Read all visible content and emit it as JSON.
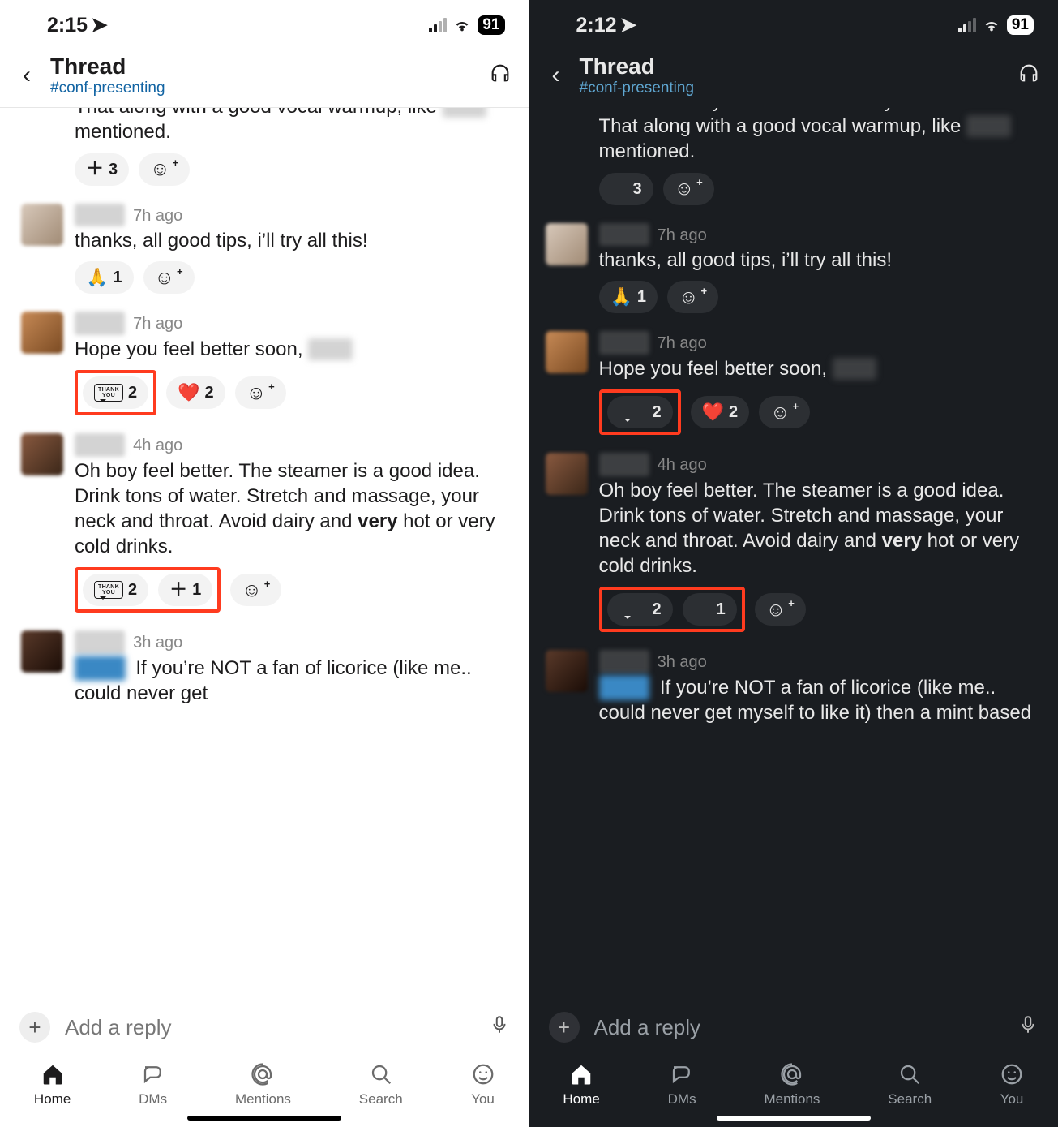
{
  "light": {
    "status": {
      "time": "2:15",
      "battery": "91"
    },
    "header": {
      "title": "Thread",
      "channel": "#conf-presenting"
    },
    "messages": [
      {
        "kind": "continuation",
        "text_parts": [
          "a ton of honey when I blew out my voice in theater. That along with a good vocal warmup, like ",
          {
            "blur": true
          },
          " mentioned."
        ],
        "reactions": [
          {
            "type": "plus",
            "count": "3"
          },
          {
            "type": "add"
          }
        ]
      },
      {
        "avatar": "av1",
        "ts": "7h ago",
        "text_parts": [
          "thanks, all good tips, i’ll try all this!"
        ],
        "reactions": [
          {
            "type": "emoji",
            "emoji": "🙏",
            "count": "1"
          },
          {
            "type": "add"
          }
        ]
      },
      {
        "avatar": "av2",
        "ts": "7h ago",
        "text_parts": [
          "Hope you feel better soon, ",
          {
            "blur": true
          }
        ],
        "reactions": [
          {
            "hl": true,
            "items": [
              {
                "type": "thankyou",
                "count": "2"
              }
            ]
          },
          {
            "type": "emoji",
            "emoji": "❤️",
            "count": "2"
          },
          {
            "type": "add"
          }
        ]
      },
      {
        "avatar": "av3",
        "ts": "4h ago",
        "text_parts": [
          "Oh boy feel better. The steamer is a good idea. Drink tons of water. Stretch and massage, your neck and throat. Avoid dairy and ",
          {
            "bold": "very"
          },
          " hot or very cold drinks."
        ],
        "reactions": [
          {
            "hl": true,
            "items": [
              {
                "type": "thankyou",
                "count": "2"
              },
              {
                "type": "plus",
                "count": "1"
              }
            ]
          },
          {
            "type": "add"
          }
        ]
      },
      {
        "avatar": "av4",
        "ts": "3h ago",
        "text_parts": [
          {
            "mention": true
          },
          " If you’re NOT a fan of licorice (like me.. could never get"
        ]
      }
    ],
    "input": {
      "placeholder": "Add a reply"
    },
    "tabs": [
      {
        "id": "home",
        "label": "Home",
        "active": true
      },
      {
        "id": "dms",
        "label": "DMs"
      },
      {
        "id": "mentions",
        "label": "Mentions"
      },
      {
        "id": "search",
        "label": "Search"
      },
      {
        "id": "you",
        "label": "You"
      }
    ]
  },
  "dark": {
    "status": {
      "time": "2:12",
      "battery": "91"
    },
    "header": {
      "title": "Thread",
      "channel": "#conf-presenting"
    },
    "messages": [
      {
        "kind": "continuation",
        "text_parts": [
          "a ton of honey when I blew out my voice in theater. That along with a good vocal warmup, like ",
          {
            "blur": true
          },
          " mentioned."
        ],
        "reactions": [
          {
            "type": "plus",
            "count": "3"
          },
          {
            "type": "add"
          }
        ]
      },
      {
        "avatar": "av1",
        "ts": "7h ago",
        "text_parts": [
          "thanks, all good tips, i’ll try all this!"
        ],
        "reactions": [
          {
            "type": "emoji",
            "emoji": "🙏",
            "count": "1"
          },
          {
            "type": "add"
          }
        ]
      },
      {
        "avatar": "av2",
        "ts": "7h ago",
        "text_parts": [
          "Hope you feel better soon, ",
          {
            "blur": true
          }
        ],
        "reactions": [
          {
            "hl": true,
            "items": [
              {
                "type": "thankyou",
                "count": "2"
              }
            ]
          },
          {
            "type": "emoji",
            "emoji": "❤️",
            "count": "2"
          },
          {
            "type": "add"
          }
        ]
      },
      {
        "avatar": "av3",
        "ts": "4h ago",
        "text_parts": [
          "Oh boy feel better. The steamer is a good idea. Drink tons of water. Stretch and massage, your neck and throat. Avoid dairy and ",
          {
            "bold": "very"
          },
          " hot or very cold drinks."
        ],
        "reactions": [
          {
            "hl": true,
            "items": [
              {
                "type": "thankyou",
                "count": "2"
              },
              {
                "type": "plus",
                "count": "1"
              }
            ]
          },
          {
            "type": "add"
          }
        ]
      },
      {
        "avatar": "av4",
        "ts": "3h ago",
        "text_parts": [
          {
            "mention": true
          },
          " If you’re NOT a fan of licorice (like me.. could never get myself to like it)  then a mint based"
        ]
      }
    ],
    "input": {
      "placeholder": "Add a reply"
    },
    "tabs": [
      {
        "id": "home",
        "label": "Home",
        "active": true
      },
      {
        "id": "dms",
        "label": "DMs"
      },
      {
        "id": "mentions",
        "label": "Mentions"
      },
      {
        "id": "search",
        "label": "Search"
      },
      {
        "id": "you",
        "label": "You"
      }
    ]
  }
}
